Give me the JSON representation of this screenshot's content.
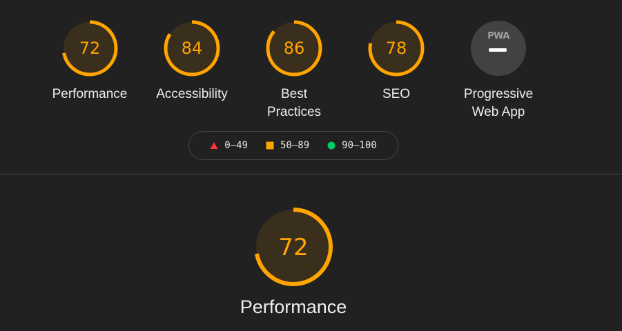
{
  "categories": [
    {
      "id": "performance",
      "label": "Performance",
      "score": 72
    },
    {
      "id": "accessibility",
      "label": "Accessibility",
      "score": 84
    },
    {
      "id": "best-practices",
      "label": "Best Practices",
      "score": 86
    },
    {
      "id": "seo",
      "label": "SEO",
      "score": 78
    }
  ],
  "pwa": {
    "label": "Progressive Web App",
    "badge_text": "PWA"
  },
  "legend": [
    {
      "range": "0–49",
      "shape": "triangle",
      "color": "#f33"
    },
    {
      "range": "50–89",
      "shape": "square",
      "color": "#ffa400"
    },
    {
      "range": "90–100",
      "shape": "circle",
      "color": "#0c6"
    }
  ],
  "featured": {
    "label": "Performance",
    "score": 72
  },
  "colors": {
    "average": "#ffa400",
    "track_fill": "#3a2f1c",
    "pwa_bg": "#424242",
    "background": "#212121"
  }
}
